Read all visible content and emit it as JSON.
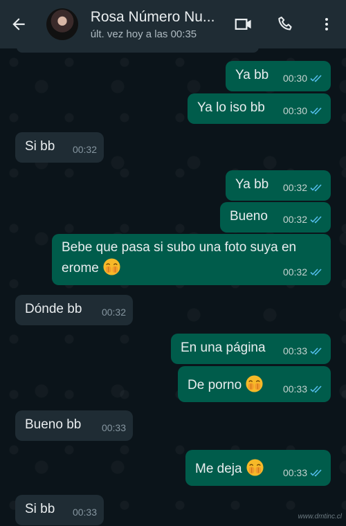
{
  "header": {
    "title": "Rosa Número Nu...",
    "subtitle": "últ. vez hoy a las 00:35",
    "icons": [
      "back-arrow-icon",
      "video-call-icon",
      "phone-icon",
      "more-vert-icon"
    ]
  },
  "colors": {
    "header_bg": "#1f2c34",
    "chat_bg": "#0b141a",
    "outgoing_bubble": "#005c4b",
    "incoming_bubble": "#1f2c34",
    "read_ticks": "#53bdeb"
  },
  "messages": [
    {
      "dir": "out",
      "text": "Ya bb",
      "time": "00:30"
    },
    {
      "dir": "out",
      "text": "Ya lo iso bb",
      "time": "00:30"
    },
    {
      "dir": "in",
      "text": "Si bb",
      "time": "00:32"
    },
    {
      "dir": "out",
      "text": "Ya bb",
      "time": "00:32"
    },
    {
      "dir": "out",
      "text": "Bueno",
      "time": "00:32"
    },
    {
      "dir": "out",
      "text": "Bebe que pasa si subo una foto suya en",
      "text2": "erome",
      "time": "00:32",
      "emoji": "face-with-hands-over-mouth"
    },
    {
      "dir": "in",
      "text": "Dónde bb",
      "time": "00:32"
    },
    {
      "dir": "out",
      "text": "En una página",
      "time": "00:33"
    },
    {
      "dir": "out",
      "text": "De porno",
      "time": "00:33",
      "emoji": "face-with-hands-over-mouth"
    },
    {
      "dir": "in",
      "text": "Bueno bb",
      "time": "00:33"
    },
    {
      "dir": "out",
      "text": "Me deja",
      "time": "00:33",
      "emoji": "face-with-hands-over-mouth"
    },
    {
      "dir": "in",
      "text": "Si bb",
      "time": "00:33"
    }
  ],
  "watermark": "www.dmtinc.cl"
}
